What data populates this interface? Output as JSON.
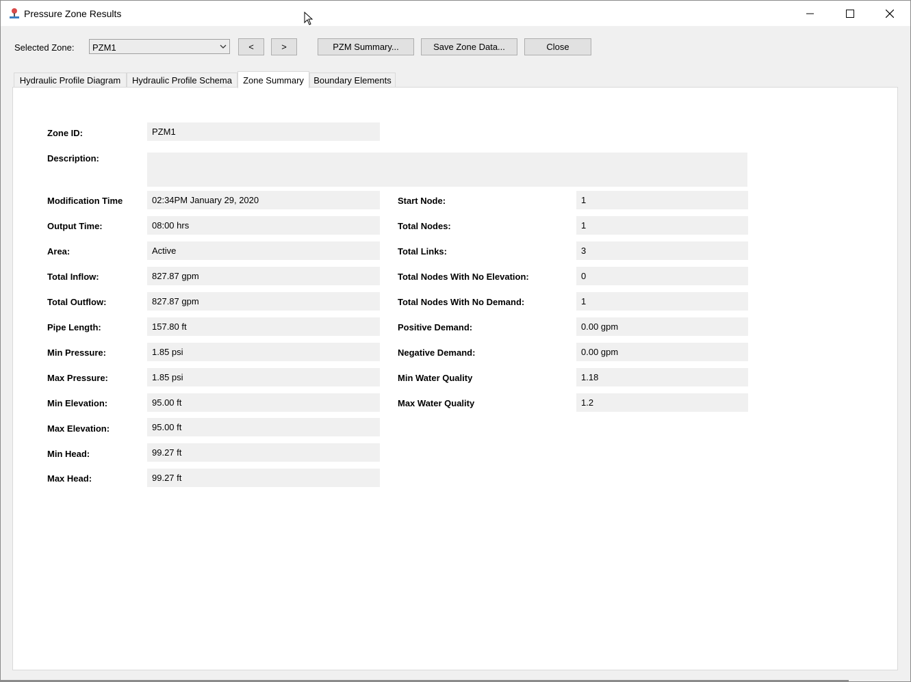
{
  "window": {
    "title": "Pressure Zone Results"
  },
  "toolbar": {
    "selected_zone_label": "Selected Zone:",
    "selected_zone_value": "PZM1",
    "prev_label": "<",
    "next_label": ">",
    "pzm_summary_label": "PZM Summary...",
    "save_zone_label": "Save Zone Data...",
    "close_label": "Close"
  },
  "tabs": [
    {
      "label": "Hydraulic Profile Diagram"
    },
    {
      "label": "Hydraulic Profile Schema"
    },
    {
      "label": "Zone Summary"
    },
    {
      "label": "Boundary Elements"
    }
  ],
  "summary": {
    "zone_id": {
      "label": "Zone ID:",
      "value": "PZM1"
    },
    "description": {
      "label": "Description:",
      "value": ""
    },
    "left": [
      {
        "label": "Modification Time",
        "value": "02:34PM January 29, 2020"
      },
      {
        "label": "Output Time:",
        "value": "08:00 hrs"
      },
      {
        "label": "Area:",
        "value": "Active"
      },
      {
        "label": "Total Inflow:",
        "value": "827.87 gpm"
      },
      {
        "label": "Total Outflow:",
        "value": "827.87 gpm"
      },
      {
        "label": "Pipe Length:",
        "value": "157.80 ft"
      },
      {
        "label": "Min Pressure:",
        "value": "1.85 psi"
      },
      {
        "label": "Max Pressure:",
        "value": "1.85 psi"
      },
      {
        "label": "Min Elevation:",
        "value": "95.00 ft"
      },
      {
        "label": "Max Elevation:",
        "value": "95.00 ft"
      },
      {
        "label": "Min Head:",
        "value": "99.27 ft"
      },
      {
        "label": "Max Head:",
        "value": "99.27 ft"
      }
    ],
    "right": [
      {
        "label": "Start Node:",
        "value": "1"
      },
      {
        "label": "Total Nodes:",
        "value": "1"
      },
      {
        "label": "Total Links:",
        "value": "3"
      },
      {
        "label": "Total Nodes With No Elevation:",
        "value": "0"
      },
      {
        "label": "Total Nodes With No Demand:",
        "value": "1"
      },
      {
        "label": "Positive Demand:",
        "value": "0.00 gpm"
      },
      {
        "label": "Negative Demand:",
        "value": "0.00 gpm"
      },
      {
        "label": "Min Water Quality",
        "value": "1.18"
      },
      {
        "label": "Max Water Quality",
        "value": "1.2"
      }
    ]
  }
}
